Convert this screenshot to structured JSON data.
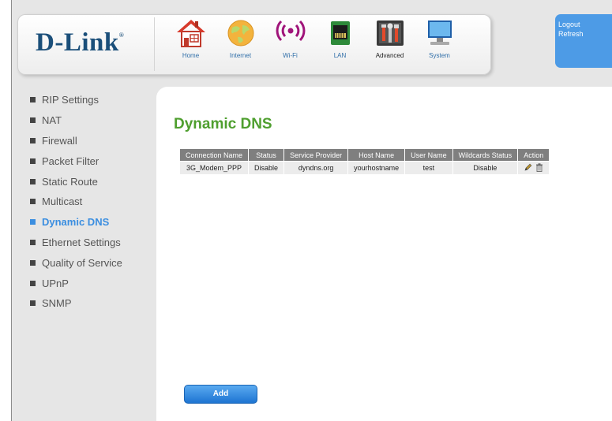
{
  "brand": {
    "logo": "D-Link",
    "logo_mark": "®"
  },
  "nav": [
    {
      "label": "Home",
      "icon": "home-icon"
    },
    {
      "label": "Internet",
      "icon": "globe-icon"
    },
    {
      "label": "Wi-Fi",
      "icon": "wifi-icon"
    },
    {
      "label": "LAN",
      "icon": "lan-port-icon"
    },
    {
      "label": "Advanced",
      "icon": "tools-icon",
      "active": true
    },
    {
      "label": "System",
      "icon": "monitor-icon"
    }
  ],
  "user_box": {
    "logout": "Logout",
    "refresh": "Refresh"
  },
  "sidebar": {
    "items": [
      {
        "label": "RIP Settings"
      },
      {
        "label": "NAT"
      },
      {
        "label": "Firewall"
      },
      {
        "label": "Packet Filter"
      },
      {
        "label": "Static Route"
      },
      {
        "label": "Multicast"
      },
      {
        "label": "Dynamic DNS",
        "active": true
      },
      {
        "label": "Ethernet Settings"
      },
      {
        "label": "Quality of Service"
      },
      {
        "label": "UPnP"
      },
      {
        "label": "SNMP"
      }
    ]
  },
  "page": {
    "title": "Dynamic DNS"
  },
  "table": {
    "headers": [
      "Connection Name",
      "Status",
      "Service Provider",
      "Host Name",
      "User Name",
      "Wildcards Status",
      "Action"
    ],
    "rows": [
      {
        "connection_name": "3G_Modem_PPP",
        "status": "Disable",
        "service_provider": "dyndns.org",
        "host_name": "yourhostname",
        "user_name": "test",
        "wildcards_status": "Disable"
      }
    ],
    "action_icons": [
      "edit-pencil-icon",
      "delete-trash-icon"
    ]
  },
  "buttons": {
    "add": "Add"
  },
  "colors": {
    "brand_blue": "#1b4f7a",
    "accent_blue": "#3b8ee0",
    "title_green": "#4f9f2f",
    "user_box_blue": "#4d9be6",
    "table_header_gray": "#7f7f7f"
  }
}
